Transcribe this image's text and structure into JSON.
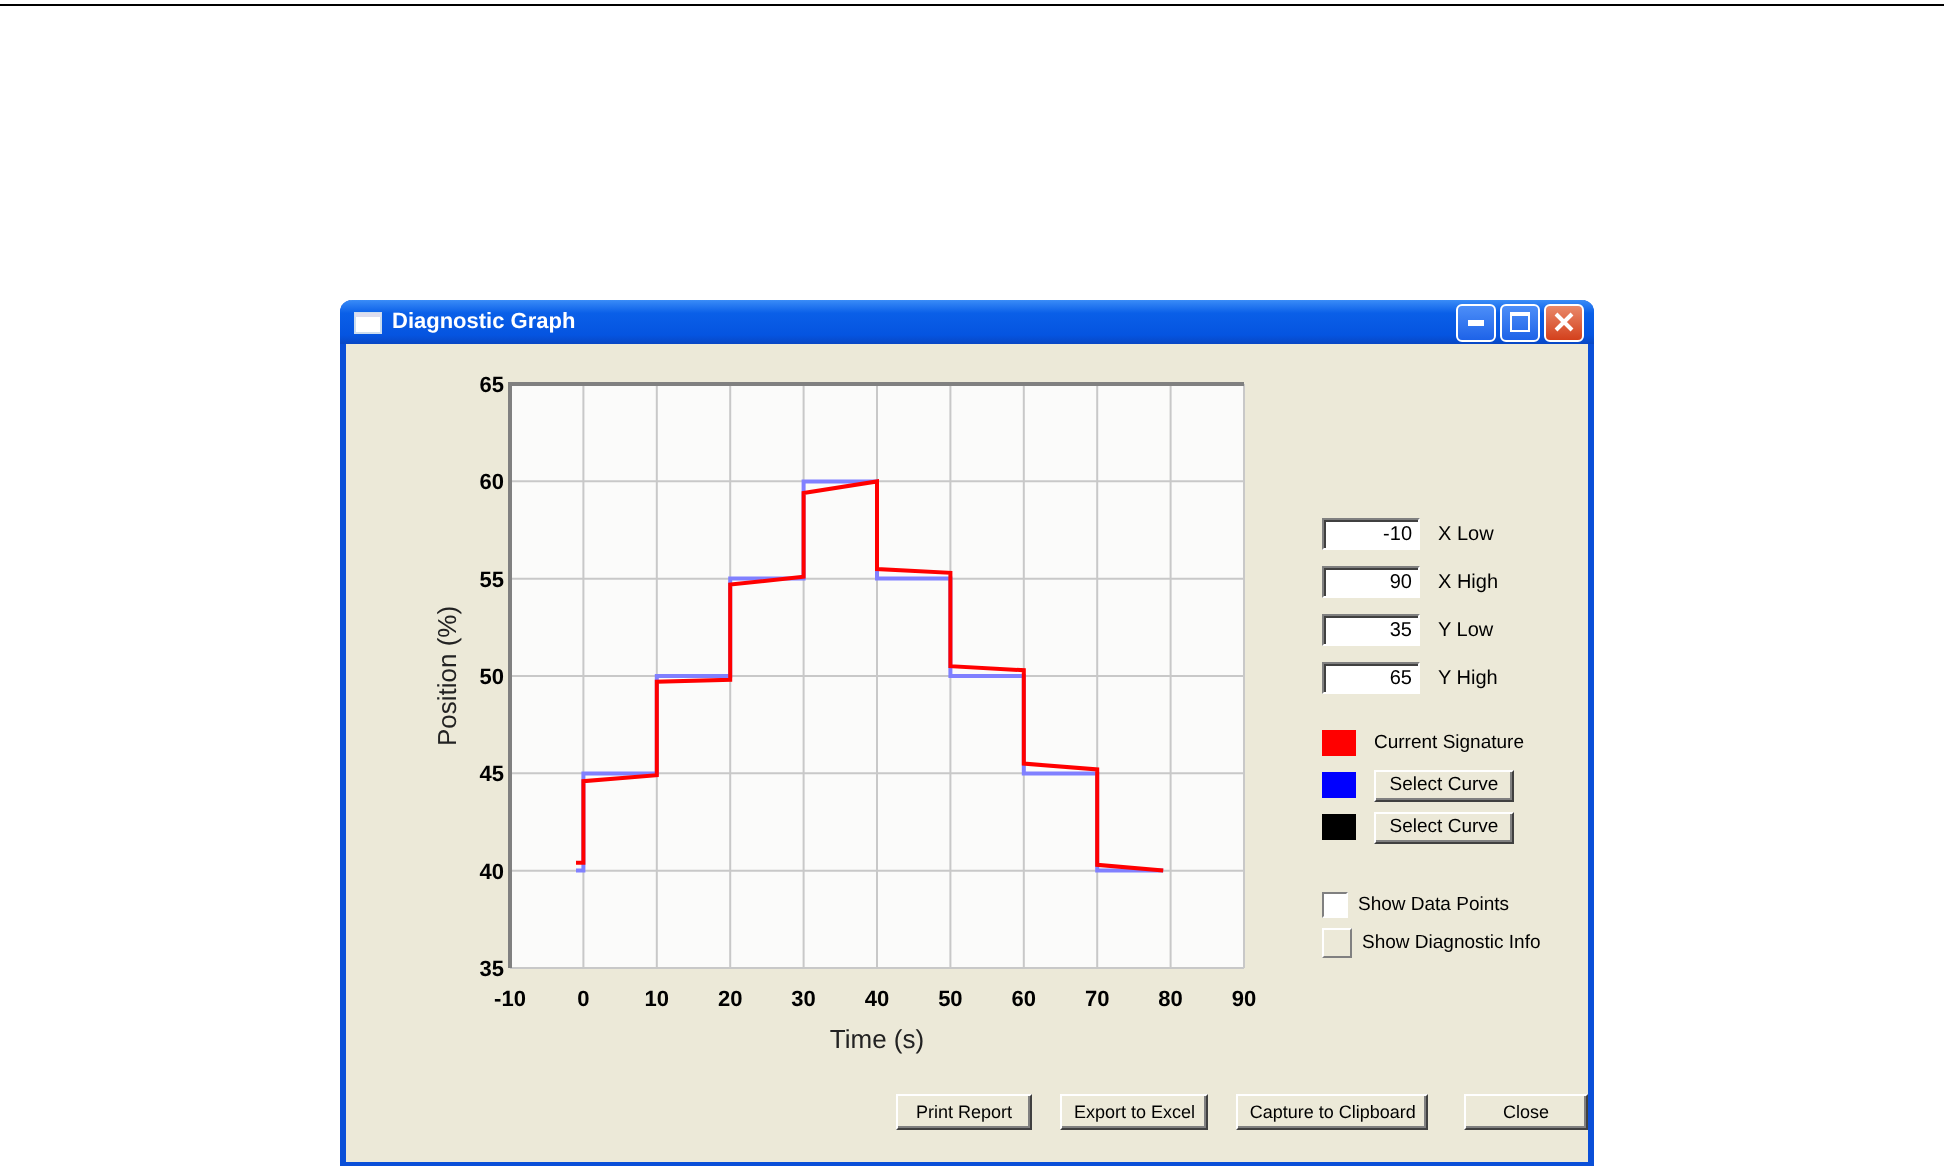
{
  "window": {
    "title": "Diagnostic Graph"
  },
  "chart": {
    "chart_data": {
      "type": "line",
      "xlabel": "Time (s)",
      "ylabel": "Position (%)",
      "grid": true,
      "xlim": [
        -10,
        90
      ],
      "ylim": [
        35,
        65
      ],
      "xticks": [
        -10,
        0,
        10,
        20,
        30,
        40,
        50,
        60,
        70,
        80,
        90
      ],
      "yticks": [
        35,
        40,
        45,
        50,
        55,
        60,
        65
      ],
      "x": [
        -1,
        0,
        0,
        10,
        10,
        20,
        20,
        30,
        30,
        40,
        40,
        50,
        50,
        60,
        60,
        70,
        70,
        79
      ],
      "series": [
        {
          "color": "#8080ff",
          "values": [
            40,
            40,
            45,
            45,
            50,
            50,
            55,
            55,
            60,
            60,
            55,
            55,
            50,
            50,
            45,
            45,
            40,
            40
          ]
        },
        {
          "color": "#ff0000",
          "values": [
            40.4,
            40.4,
            44.6,
            44.9,
            49.7,
            49.8,
            54.7,
            55.1,
            59.4,
            60,
            55.5,
            55.3,
            50.5,
            50.3,
            45.5,
            45.2,
            40.3,
            40
          ]
        }
      ]
    }
  },
  "range_fields": [
    {
      "value": "-10",
      "label": "X Low"
    },
    {
      "value": "90",
      "label": "X High"
    },
    {
      "value": "35",
      "label": "Y Low"
    },
    {
      "value": "65",
      "label": "Y High"
    }
  ],
  "curves": [
    {
      "kind": "label",
      "color": "#ff0000",
      "label": "Current Signature"
    },
    {
      "kind": "button",
      "color": "#0000ff",
      "label": "Select Curve"
    },
    {
      "kind": "button",
      "color": "#000000",
      "label": "Select Curve"
    }
  ],
  "options": [
    {
      "kind": "checkbox",
      "label": "Show Data Points",
      "checked": false
    },
    {
      "kind": "toggle",
      "label": "Show Diagnostic Info",
      "checked": false
    }
  ],
  "buttons": [
    "Print Report",
    "Export to Excel",
    "Capture to Clipboard",
    "Close"
  ]
}
